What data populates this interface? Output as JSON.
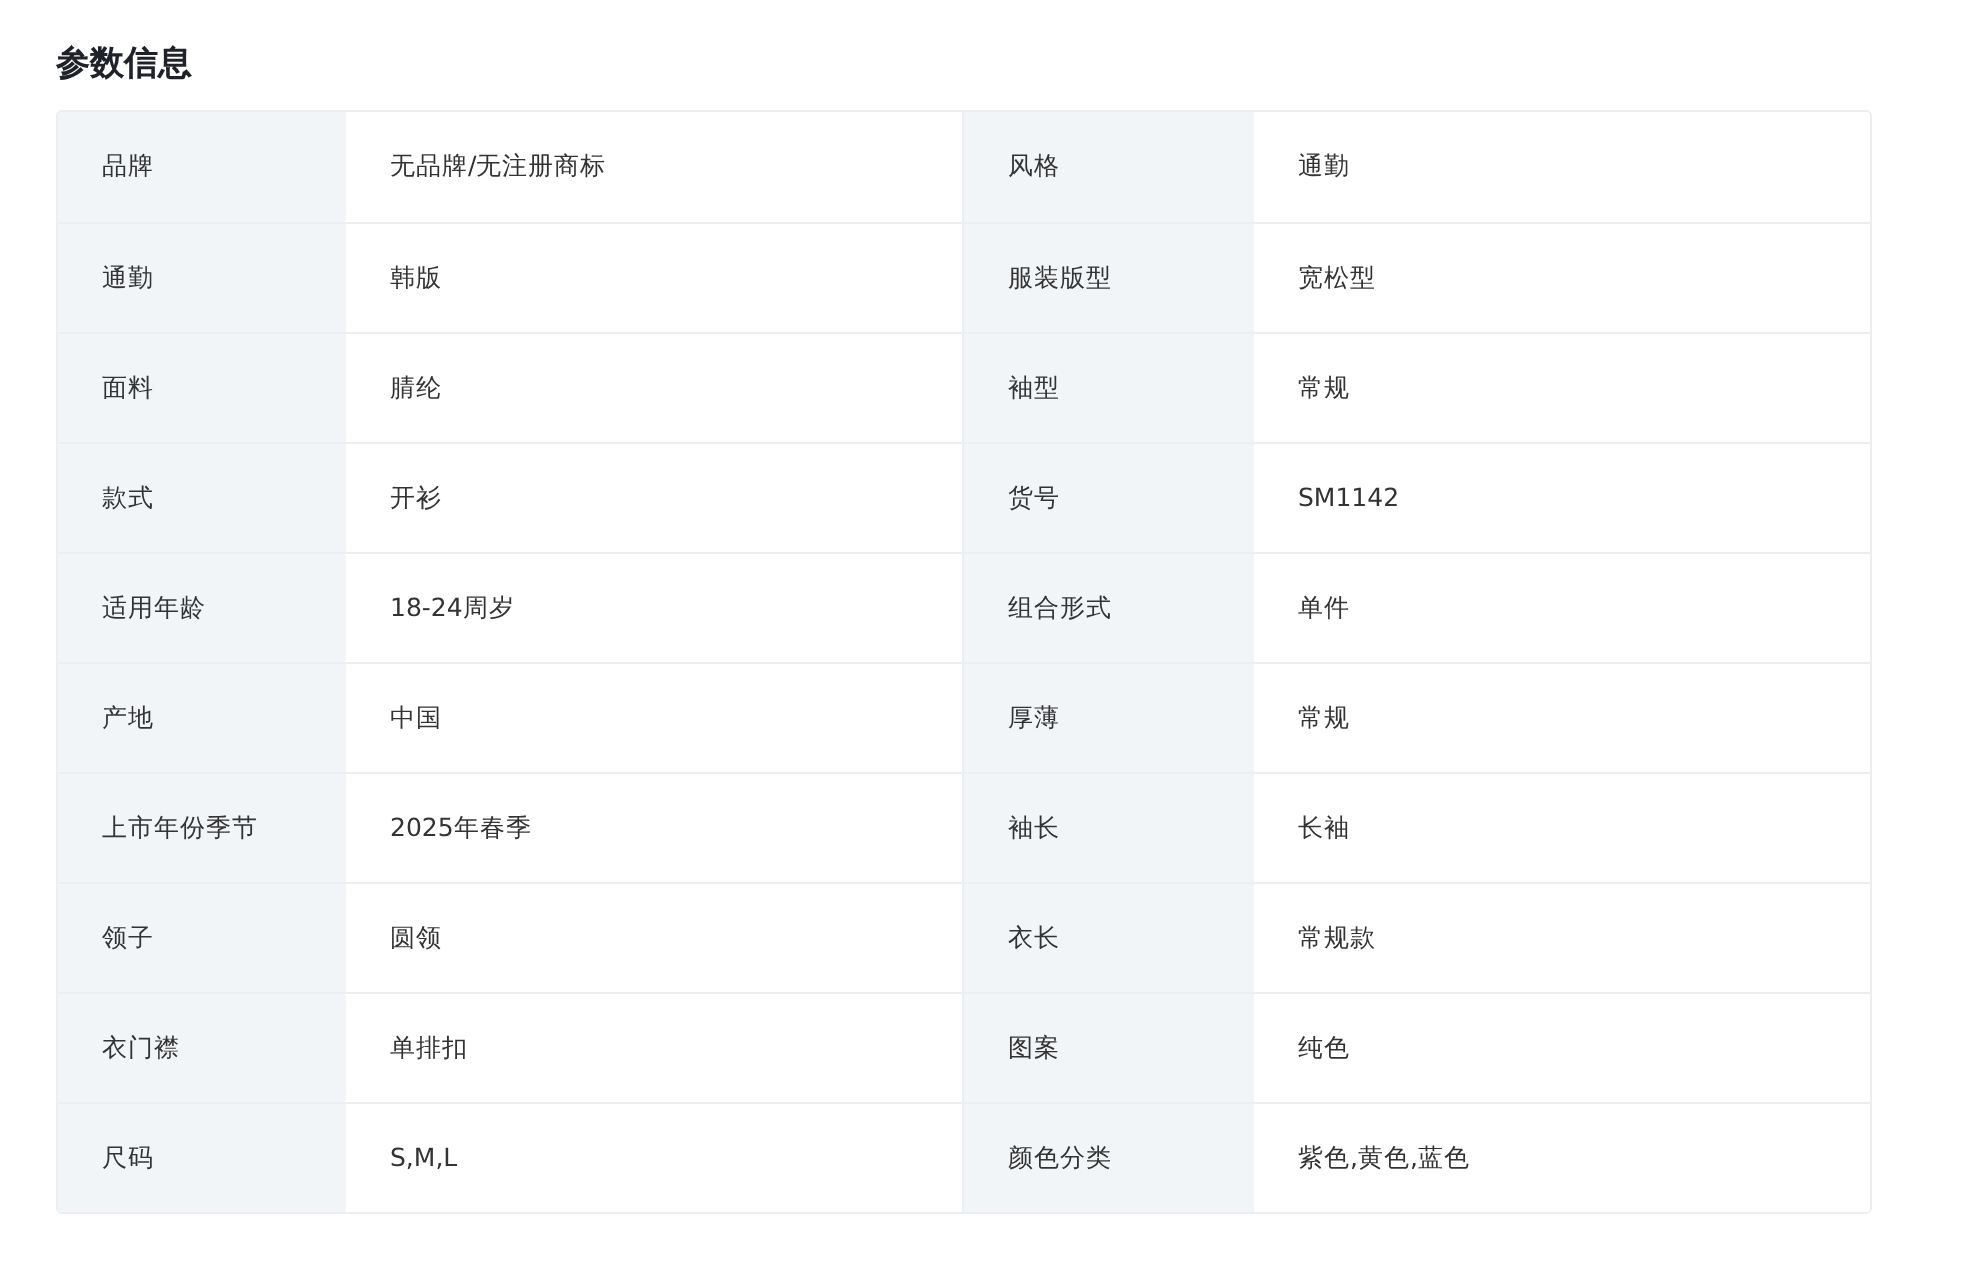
{
  "title": "参数信息",
  "rows": [
    [
      {
        "label": "品牌",
        "value": "无品牌/无注册商标"
      },
      {
        "label": "风格",
        "value": "通勤"
      }
    ],
    [
      {
        "label": "通勤",
        "value": "韩版"
      },
      {
        "label": "服装版型",
        "value": "宽松型"
      }
    ],
    [
      {
        "label": "面料",
        "value": "腈纶"
      },
      {
        "label": "袖型",
        "value": "常规"
      }
    ],
    [
      {
        "label": "款式",
        "value": "开衫"
      },
      {
        "label": "货号",
        "value": "SM1142"
      }
    ],
    [
      {
        "label": "适用年龄",
        "value": "18-24周岁"
      },
      {
        "label": "组合形式",
        "value": "单件"
      }
    ],
    [
      {
        "label": "产地",
        "value": "中国"
      },
      {
        "label": "厚薄",
        "value": "常规"
      }
    ],
    [
      {
        "label": "上市年份季节",
        "value": "2025年春季"
      },
      {
        "label": "袖长",
        "value": "长袖"
      }
    ],
    [
      {
        "label": "领子",
        "value": "圆领"
      },
      {
        "label": "衣长",
        "value": "常规款"
      }
    ],
    [
      {
        "label": "衣门襟",
        "value": "单排扣"
      },
      {
        "label": "图案",
        "value": "纯色"
      }
    ],
    [
      {
        "label": "尺码",
        "value": "S,M,L"
      },
      {
        "label": "颜色分类",
        "value": "紫色,黄色,蓝色"
      }
    ]
  ]
}
